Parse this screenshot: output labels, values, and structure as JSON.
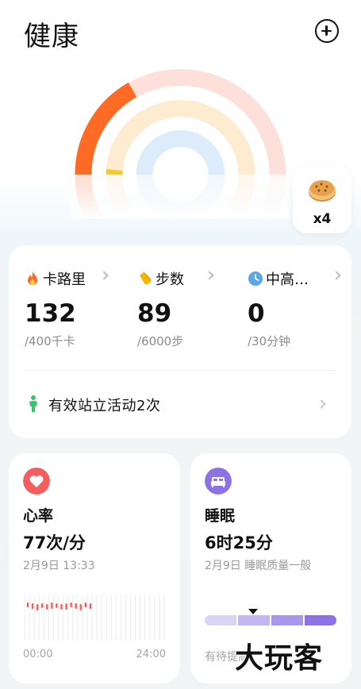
{
  "header": {
    "title": "健康"
  },
  "reward": {
    "count_label": "x4",
    "icon": "cookie-icon"
  },
  "activity": {
    "metrics": [
      {
        "label": "卡路里",
        "value": "132",
        "goal": "/400千卡",
        "icon": "flame-icon",
        "color": "#ff6a24"
      },
      {
        "label": "步数",
        "value": "89",
        "goal": "/6000步",
        "icon": "shoe-icon",
        "color": "#f6b600"
      },
      {
        "label": "中高…",
        "value": "0",
        "goal": "/30分钟",
        "icon": "clock-icon",
        "color": "#5aa7e8"
      }
    ],
    "stand_text": "有效站立活动2次",
    "rings": {
      "calories_progress": 0.33,
      "steps_progress": 0.015,
      "intensity_progress": 0.0
    }
  },
  "heart": {
    "title": "心率",
    "value": "77次/分",
    "date": "2月9日 13:33",
    "axis_start": "00:00",
    "axis_end": "24:00",
    "icon": "heart-icon",
    "accent": "#f35f5f"
  },
  "sleep": {
    "title": "睡眠",
    "value": "6时25分",
    "summary": "2月9日 睡眠质量一般",
    "note": "有待提高",
    "icon": "bed-icon",
    "accent": "#8b73e6"
  },
  "watermark": {
    "text": "大玩客"
  }
}
